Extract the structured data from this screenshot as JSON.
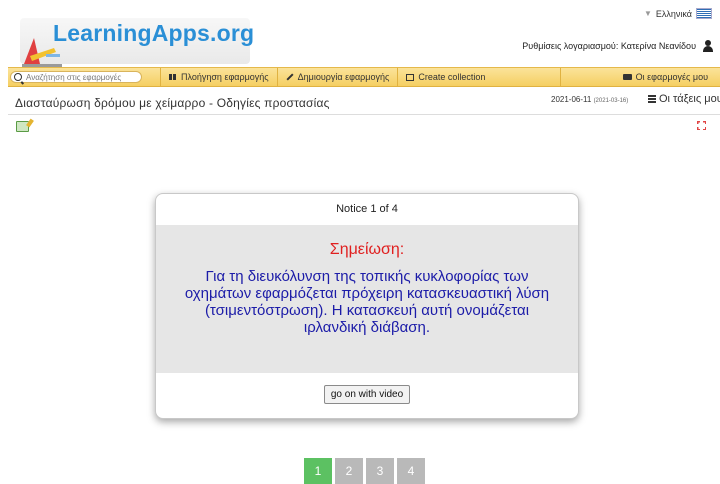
{
  "header": {
    "logo_text": "LearningApps.org",
    "language": "Ελληνικά",
    "account_text": "Ρυθμίσεις λογαριασμού: Κατερίνα Νεανίδου"
  },
  "nav": {
    "search_placeholder": "Αναζήτηση στις εφαρμογές",
    "browse": "Πλοήγηση εφαρμογής",
    "create": "Δημιουργία εφαρμογής",
    "collection": "Create collection",
    "my_apps": "Οι εφαρμογές μου"
  },
  "app": {
    "title": "Διασταύρωση δρόμου με χείμαρρο - Οδηγίες προστασίας",
    "date": "2021-06-11",
    "date_small": "(2021-03-16)",
    "classes": "Οι τάξεις μου"
  },
  "dialog": {
    "header": "Notice 1 of 4",
    "label": "Σημείωση:",
    "text": "Για τη διευκόλυνση της τοπικής κυκλοφορίας των οχημάτων εφαρμόζεται πρόχειρη κατασκευαστική λύση (τσιμεντόστρωση). Η κατασκευή αυτή ονομάζεται ιρλανδική διάβαση.",
    "button": "go on with video"
  },
  "pagination": [
    "1",
    "2",
    "3",
    "4"
  ],
  "active_page": "1",
  "colors": {
    "accent_green": "#5cc162",
    "nav_yellow": "#f5cf62",
    "logo_blue": "#2a8fd6",
    "notice_red": "#e02020",
    "notice_text_blue": "#1c1ca8"
  }
}
